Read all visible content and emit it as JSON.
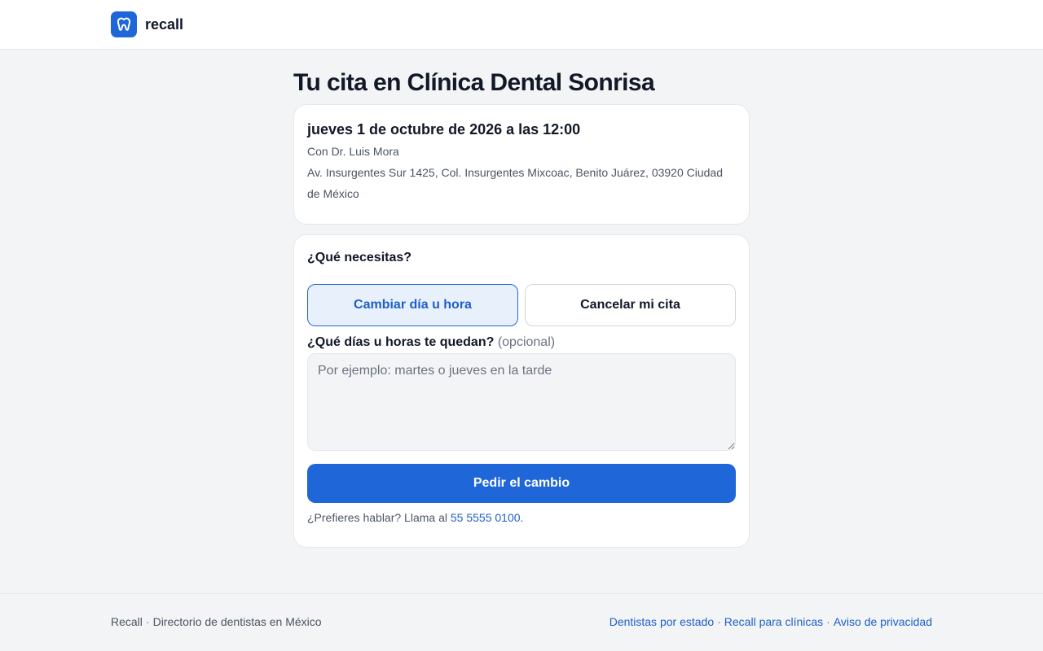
{
  "header": {
    "brand_name": "recall",
    "logo_icon": "tooth-icon",
    "accent_color": "#1f66d8"
  },
  "appointment": {
    "page_title": "Tu cita en Clínica Dental Sonrisa",
    "date_time": "jueves 1 de octubre de 2026 a las 12:00",
    "doctor": "Con Dr. Luis Mora",
    "address": "Av. Insurgentes Sur 1425, Col. Insurgentes Mixcoac, Benito Juárez, 03920 Ciudad de México"
  },
  "request": {
    "question": "¿Qué necesitas?",
    "options": [
      {
        "label": "Cambiar día u hora",
        "selected": true
      },
      {
        "label": "Cancelar mi cita",
        "selected": false
      }
    ],
    "field_label": "¿Qué días u horas te quedan?",
    "field_optional": "(opcional)",
    "field_value": "",
    "field_placeholder": "Por ejemplo: martes o jueves en la tarde",
    "submit_label": "Pedir el cambio",
    "call_prefix": "¿Prefieres hablar? Llama al",
    "phone": "55 5555 0100",
    "call_suffix": "."
  },
  "footer": {
    "brand": "Recall",
    "separator": "·",
    "tagline": "Directorio de dentistas en México",
    "links": [
      "Dentistas por estado",
      "Recall para clínicas",
      "Aviso de privacidad"
    ]
  }
}
